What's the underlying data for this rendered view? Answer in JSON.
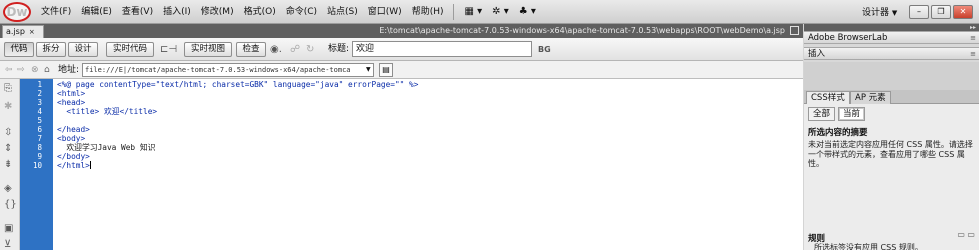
{
  "menubar": {
    "logo": "Dw",
    "items": [
      "文件(F)",
      "编辑(E)",
      "查看(V)",
      "插入(I)",
      "修改(M)",
      "格式(O)",
      "命令(C)",
      "站点(S)",
      "窗口(W)",
      "帮助(H)"
    ],
    "tool_icons": [
      "▦ ▾",
      "✲ ▾",
      "♣ ▾"
    ],
    "designer": "设计器",
    "window_buttons": [
      "–",
      "❐",
      "✕"
    ]
  },
  "document": {
    "tab": "a.jsp",
    "tab_close": "×",
    "path": "E:\\tomcat\\apache-tomcat-7.0.53-windows-x64\\apache-tomcat-7.0.53\\webapps\\ROOT\\webDemo\\a.jsp"
  },
  "toolbar": {
    "code_btn": "代码",
    "split_btn": "拆分",
    "design_btn": "设计",
    "live_code_btn": "实时代码",
    "live_view_btn": "实时视图",
    "inspect_btn": "检查",
    "title_label": "标题:",
    "title_value": "欢迎",
    "bd_icon": "BG"
  },
  "address": {
    "label": "地址:",
    "value": "file:///E|/tomcat/apache-tomcat-7.0.53-windows-x64/apache-tomca"
  },
  "code": {
    "line_numbers": [
      "1",
      "2",
      "3",
      "4",
      "5",
      "6",
      "7",
      "8",
      "9",
      "10"
    ],
    "lines": [
      "<%@ page contentType=\"text/html; charset=GBK\" language=\"java\" errorPage=\"\" %>",
      "<html>",
      "<head>",
      "  <title> 欢迎</title>",
      "",
      "</head>",
      "<body>",
      "  欢迎学习Java Web 知识",
      "</body>",
      "</html>"
    ]
  },
  "panels": {
    "browserlab": "Adobe BrowserLab",
    "insert": "插入",
    "tabs": [
      "CSS样式",
      "AP 元素"
    ],
    "subtabs": [
      "全部",
      "当前"
    ],
    "summary_title": "所选内容的摘要",
    "summary_text": "未对当前选定内容应用任何 CSS 属性。请选择一个带样式的元素，查看应用了哪些 CSS 属性。",
    "rules_title": "规则",
    "rules_text": "所选标签没有应用 CSS 规则。"
  }
}
